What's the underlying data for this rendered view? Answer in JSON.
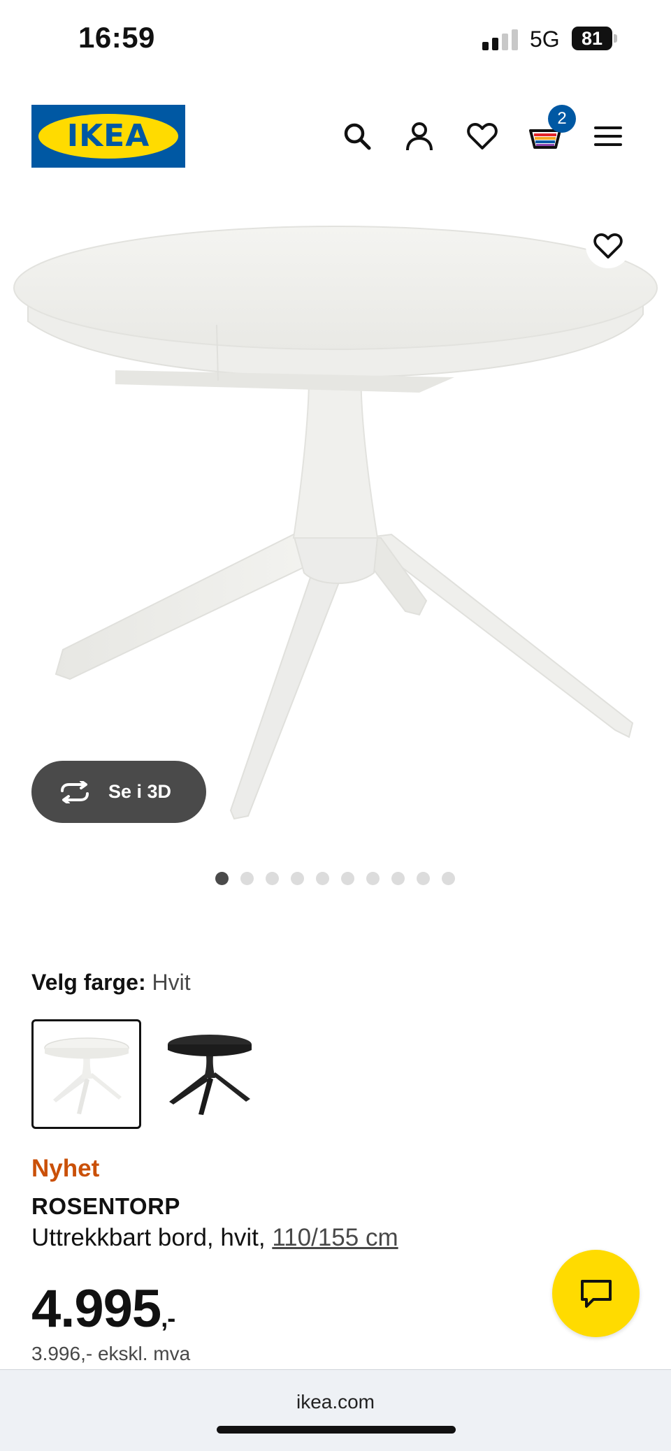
{
  "status_bar": {
    "time": "16:59",
    "network": "5G",
    "battery": "81"
  },
  "header": {
    "logo_text": "IKEA",
    "cart_count": "2"
  },
  "product": {
    "see_3d_label": "Se i 3D",
    "image_count": 10,
    "active_image_index": 0,
    "color_label": "Velg farge:",
    "color_value": "Hvit",
    "color_options": [
      "white",
      "black"
    ],
    "badge": "Nyhet",
    "name": "ROSENTORP",
    "description": "Uttrekkbart bord, hvit,",
    "size": "110/155 cm",
    "price": "4.995",
    "price_suffix": ",-",
    "price_ex_vat": "3.996,- ekskl. mva"
  },
  "browser": {
    "url": "ikea.com"
  },
  "colors": {
    "ikea_blue": "#0058a3",
    "ikea_yellow": "#ffdb00",
    "new_badge": "#ca5008",
    "button_dark": "#4a4a4a"
  }
}
